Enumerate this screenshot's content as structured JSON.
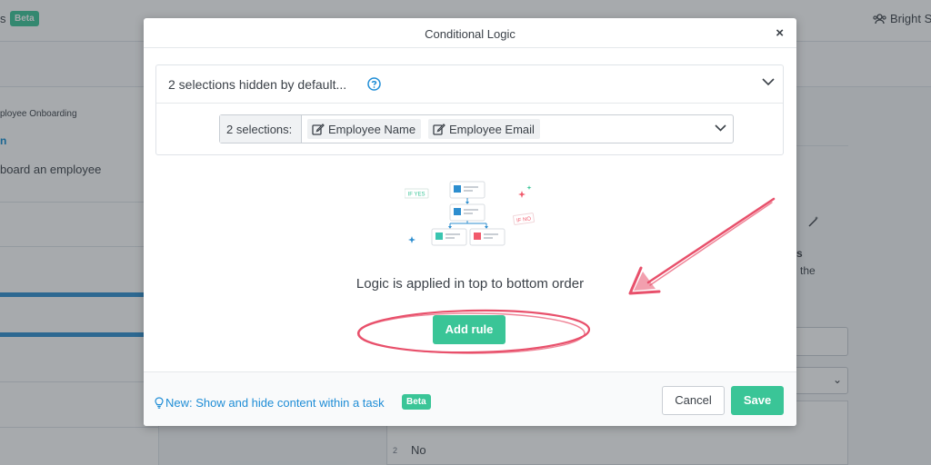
{
  "background": {
    "brand_tail": "s",
    "brand_badge": "Beta",
    "org_name": "Bright S",
    "breadcrumb": "ployee Onboarding",
    "link_fragment": "n",
    "description": "board an employee",
    "right_text_bold": "s",
    "right_text": "the",
    "list_number": "2",
    "list_value": "No"
  },
  "modal": {
    "title": "Conditional Logic",
    "close_label": "×",
    "hidden_label": "2 selections hidden by default...",
    "selection_count": "2 selections:",
    "selections": [
      "Employee Name",
      "Employee Email"
    ],
    "illustration": {
      "if_yes": "IF YES",
      "if_no": "IF NO"
    },
    "logic_text": "Logic is applied in top to bottom order",
    "add_rule_label": "Add rule",
    "footer": {
      "link_text": "New: Show and hide content within a task",
      "badge": "Beta",
      "cancel_label": "Cancel",
      "save_label": "Save"
    }
  },
  "colors": {
    "accent_green": "#3ac597",
    "link_blue": "#1f8dd6",
    "annotation_pink": "#e8506b"
  },
  "icons": {
    "help": "question-circle-icon",
    "expand": "chevron-down-icon",
    "field": "edit-icon",
    "tip": "lightbulb-icon",
    "org": "users-icon"
  }
}
